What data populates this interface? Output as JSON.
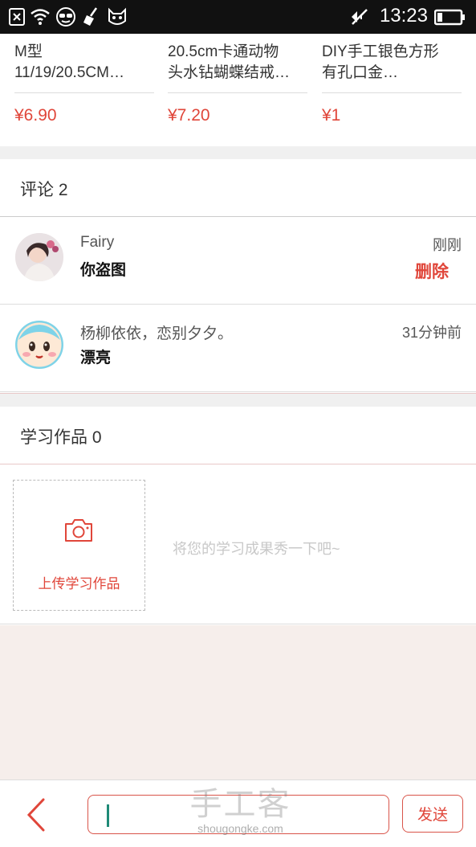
{
  "status_bar": {
    "time": "13:23"
  },
  "products": [
    {
      "title": "M型\n11/19/20.5CM…",
      "price": "¥6.90"
    },
    {
      "title": "20.5cm卡通动物\n头水钻蝴蝶结戒…",
      "price": "¥7.20"
    },
    {
      "title": "DIY手工银色方形\n有孔口金…",
      "price": "¥1"
    }
  ],
  "comments": {
    "title": "评论 2",
    "items": [
      {
        "name": "Fairy",
        "text": "你盗图",
        "time": "刚刚",
        "delete_label": "删除"
      },
      {
        "name": "杨柳依依，恋别夕夕。",
        "text": "漂亮",
        "time": "31分钟前"
      }
    ]
  },
  "works": {
    "title": "学习作品 0",
    "upload_label": "上传学习作品",
    "hint": "将您的学习成果秀一下吧~"
  },
  "bottom_bar": {
    "input_value": "",
    "send_label": "发送",
    "watermark_cn": "手工客",
    "watermark_en": "shougongke.com"
  },
  "colors": {
    "accent": "#e0463a",
    "background_empty": "#f6eeeb"
  }
}
